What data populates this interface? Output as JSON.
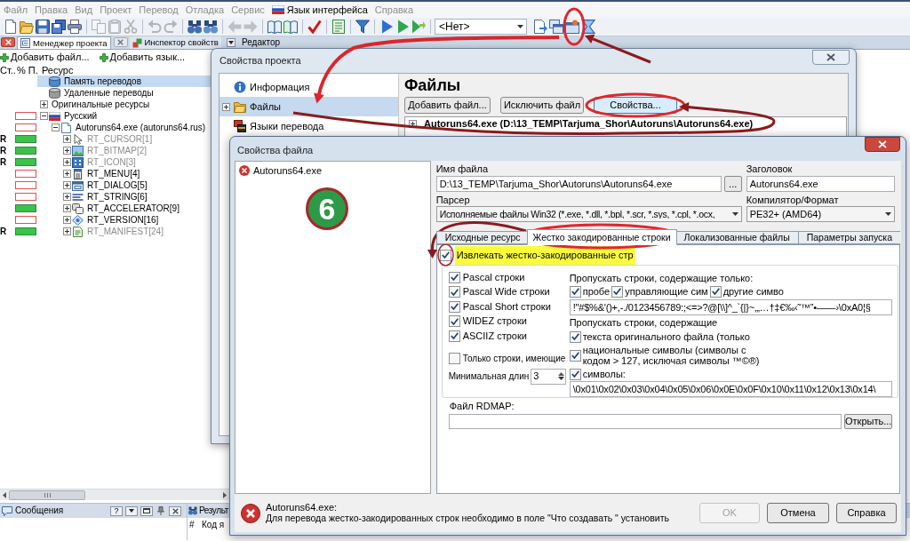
{
  "menu": [
    {
      "label": "Файл",
      "kind": "text",
      "disabled": true
    },
    {
      "label": "Правка",
      "kind": "text",
      "disabled": true
    },
    {
      "label": "Вид",
      "kind": "text",
      "disabled": true
    },
    {
      "label": "Проект",
      "kind": "text",
      "disabled": true
    },
    {
      "label": "Перевод",
      "kind": "text",
      "disabled": true
    },
    {
      "label": "Отладка",
      "kind": "text",
      "disabled": true
    },
    {
      "label": "Сервис",
      "kind": "text",
      "disabled": true
    },
    {
      "label": "Язык интерфейса",
      "kind": "flag",
      "disabled": false
    },
    {
      "label": "Справка",
      "kind": "text",
      "disabled": true
    }
  ],
  "toolbar": [
    {
      "kind": "button",
      "disabled": false
    },
    {
      "kind": "button",
      "disabled": false
    },
    {
      "kind": "button",
      "disabled": false
    },
    {
      "kind": "button",
      "disabled": false
    },
    {
      "kind": "button",
      "disabled": false
    },
    {
      "kind": "separator"
    },
    {
      "kind": "button",
      "disabled": true
    },
    {
      "kind": "button",
      "disabled": true
    },
    {
      "kind": "button",
      "disabled": true
    },
    {
      "kind": "separator"
    },
    {
      "kind": "button",
      "disabled": true
    },
    {
      "kind": "button",
      "disabled": true
    },
    {
      "kind": "separator"
    },
    {
      "kind": "button",
      "disabled": false
    },
    {
      "kind": "button",
      "disabled": false
    },
    {
      "kind": "separator"
    },
    {
      "kind": "button",
      "disabled": true
    },
    {
      "kind": "button",
      "disabled": true
    },
    {
      "kind": "separator"
    },
    {
      "kind": "button",
      "disabled": false
    },
    {
      "kind": "button",
      "disabled": false
    },
    {
      "kind": "separator"
    },
    {
      "kind": "button",
      "disabled": false
    },
    {
      "kind": "separator"
    },
    {
      "kind": "button",
      "disabled": false
    },
    {
      "kind": "separator"
    },
    {
      "kind": "button",
      "disabled": false
    },
    {
      "kind": "separator"
    },
    {
      "kind": "button",
      "disabled": false
    },
    {
      "kind": "button",
      "disabled": false
    },
    {
      "kind": "button",
      "disabled": false
    },
    {
      "kind": "separator"
    },
    {
      "kind": "combo",
      "value": "<Нет>"
    },
    {
      "kind": "button",
      "disabled": false
    },
    {
      "kind": "button",
      "disabled": false
    },
    {
      "kind": "button",
      "disabled": false
    },
    {
      "kind": "button",
      "disabled": false
    }
  ],
  "left_panel": {
    "tabs": [
      {
        "label": "Менеджер проекта",
        "selected": true
      },
      {
        "label": "Инспектор свойств",
        "selected": false
      }
    ],
    "actions": [
      "Добавить файл...",
      "Добавить язык..."
    ],
    "columns": [
      "Ст..",
      "% П.",
      "Ресурс"
    ],
    "tree": [
      {
        "label": "Память переводов",
        "kind": "memory",
        "selected": true,
        "dimmed": false
      },
      {
        "label": "Удаленные переводы",
        "kind": "deleted",
        "selected": false,
        "dimmed": false
      },
      {
        "label": "Оригинальные ресурсы",
        "kind": "group",
        "selected": false,
        "dimmed": false,
        "expanded": false
      },
      {
        "label": "Русский",
        "kind": "language",
        "selected": false,
        "dimmed": false,
        "expanded": true,
        "level": 0,
        "children": [
          {
            "label": "Autoruns64.exe (autoruns64.rus)",
            "kind": "file",
            "selected": false,
            "dimmed": false,
            "expanded": true,
            "level": 0,
            "children": [
              {
                "label": "RT_CURSOR[1]",
                "kind": "cursor",
                "selected": false,
                "dimmed": true,
                "expanded": false,
                "status": "R",
                "level": 1
              },
              {
                "label": "RT_BITMAP[2]",
                "kind": "bitmap",
                "selected": false,
                "dimmed": true,
                "expanded": false,
                "status": "R",
                "level": 1
              },
              {
                "label": "RT_ICON[3]",
                "kind": "icon",
                "selected": false,
                "dimmed": true,
                "expanded": false,
                "status": "R",
                "level": 1
              },
              {
                "label": "RT_MENU[4]",
                "kind": "menu",
                "selected": false,
                "dimmed": false,
                "expanded": false,
                "level": 0
              },
              {
                "label": "RT_DIALOG[5]",
                "kind": "dialog",
                "selected": false,
                "dimmed": false,
                "expanded": false,
                "level": 0
              },
              {
                "label": "RT_STRING[6]",
                "kind": "string",
                "selected": false,
                "dimmed": false,
                "expanded": false,
                "level": 0
              },
              {
                "label": "RT_ACCELERATOR[9]",
                "kind": "accelerator",
                "selected": false,
                "dimmed": false,
                "expanded": false,
                "level": 1
              },
              {
                "label": "RT_VERSION[16]",
                "kind": "version",
                "selected": false,
                "dimmed": false,
                "expanded": false,
                "level": 0
              },
              {
                "label": "RT_MANIFEST[24]",
                "kind": "manifest",
                "selected": false,
                "dimmed": true,
                "expanded": false,
                "status": "R",
                "level": 1
              }
            ]
          }
        ]
      }
    ]
  },
  "editor": {
    "title": "Редактор"
  },
  "messages_panel": {
    "title": "Сообщения",
    "help_button": "?"
  },
  "results_panel": {
    "title": "Результ",
    "columns": [
      "#",
      "Код я"
    ]
  },
  "project_dialog": {
    "title": "Свойства проекта",
    "nav": [
      {
        "label": "Информация",
        "kind": "info",
        "selected": false
      },
      {
        "label": "Файлы",
        "kind": "files",
        "selected": true,
        "expanded": false
      },
      {
        "label": "Языки перевода",
        "kind": "languages",
        "selected": false
      }
    ],
    "heading": "Файлы",
    "buttons": [
      {
        "label": "Добавить файл...",
        "focused": false
      },
      {
        "label": "Исключить файл",
        "focused": false
      },
      {
        "label": "Свойства...",
        "focused": true
      }
    ],
    "files": [
      {
        "label": "Autoruns64.exe (D:\\13_TEMP\\Tarjuma_Shor\\Autoruns\\Autoruns64.exe)",
        "expanded": false
      }
    ]
  },
  "file_dialog": {
    "title": "Свойства файла",
    "files": [
      {
        "label": "Autoruns64.exe",
        "error": true,
        "selected": false
      }
    ],
    "file_name": {
      "label": "Имя файла",
      "value": "D:\\13_TEMP\\Tarjuma_Shor\\Autoruns\\Autoruns64.exe",
      "button": "..."
    },
    "caption": {
      "label": "Заголовок",
      "value": "Autoruns64.exe"
    },
    "parser": {
      "label": "Парсер",
      "value": "Исполняемые файлы Win32 (*.exe, *.dll, *.bpl, *.scr, *.sys, *.cpl, *.ocx,"
    },
    "compiler": {
      "label": "Компилятор/Формат",
      "value": "PE32+ (AMD64)"
    },
    "tabs": [
      {
        "label": "Исходные ресурс",
        "selected": false
      },
      {
        "label": "Жестко закодированные строки",
        "selected": true
      },
      {
        "label": "Локализованные файлы",
        "selected": false
      },
      {
        "label": "Параметры запуска",
        "selected": false
      }
    ],
    "extract": {
      "label": "Извлекать жестко-закодированные стр",
      "checked": true,
      "highlighted": true
    },
    "string_types": [
      {
        "label": "Pascal строки",
        "checked": true
      },
      {
        "label": "Pascal Wide строки",
        "checked": true
      },
      {
        "label": "Pascal Short строки",
        "checked": true
      },
      {
        "label": "WIDEZ строки",
        "checked": true
      },
      {
        "label": "ASCIIZ строки",
        "checked": true
      }
    ],
    "only_strings": {
      "label": "Только строки, имеющие",
      "checked": false
    },
    "min_length": {
      "label": "Минимальная длин",
      "value": "3"
    },
    "skip_only": {
      "title": "Пропускать строки, содержащие только:",
      "options": [
        {
          "label": "пробе",
          "checked": true
        },
        {
          "label": "управляющие сим",
          "checked": true
        },
        {
          "label": "другие симво",
          "checked": true
        }
      ],
      "value": "!\"#$%&'()+,-./0123456789:;<=>?@[\\\\]^_`{|}~‚„…†‡€‰‹˜™”•——›\\0xA0¦§"
    },
    "skip_containing": {
      "title": "Пропускать строки, содержащие",
      "options": [
        {
          "label": "текста оригинального файла (только",
          "checked": true
        },
        {
          "label": "национальные символы (символы с кодом > 127, исключая символы ™©®)",
          "checked": true
        },
        {
          "label": "символы:",
          "checked": true
        }
      ],
      "value": "\\0x01\\0x02\\0x03\\0x04\\0x05\\0x06\\0x0E\\0x0F\\0x10\\0x11\\0x12\\0x13\\0x14\\"
    },
    "rdmap": {
      "label": "Файл RDMAP:",
      "button": "Открыть..."
    },
    "status": {
      "file": "Autoruns64.exe:",
      "message": "Для перевода жестко-закодированных строк необходимо в поле \"Что создавать \" установить",
      "error": true
    },
    "buttons": [
      {
        "label": "OK",
        "disabled": true
      },
      {
        "label": "Отмена",
        "disabled": false
      },
      {
        "label": "Справка",
        "disabled": false
      }
    ]
  },
  "step_badge": "6"
}
